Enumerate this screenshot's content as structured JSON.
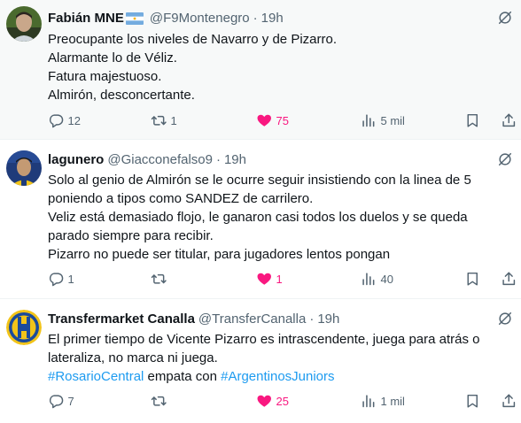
{
  "colors": {
    "like_active": "#f91880",
    "hashtag": "#1d9bf0",
    "secondary_text": "#536471",
    "primary_text": "#0f1419"
  },
  "tweets": [
    {
      "display_name": "Fabián MNE",
      "has_flag": "argentina-flag",
      "handle": "@F9Montenegro",
      "time": "19h",
      "lines": [
        "Preocupante los niveles de Navarro y de Pizarro.",
        "Alarmante lo de Véliz.",
        "Fatura majestuoso.",
        "Almirón, desconcertante."
      ],
      "replies": "12",
      "retweets": "1",
      "likes": "75",
      "views": "5 mil"
    },
    {
      "display_name": "lagunero",
      "handle": "@Giacconefalso9",
      "time": "19h",
      "lines": [
        "Solo al genio de Almirón se le ocurre seguir insistiendo con la linea de 5",
        "poniendo a tipos como SANDEZ de carrilero.",
        "Veliz está demasiado flojo, le ganaron casi todos los duelos y se queda",
        "parado siempre para recibir.",
        "Pizarro no puede ser titular, para jugadores lentos pongan"
      ],
      "replies": "1",
      "retweets": "",
      "likes": "1",
      "views": "40"
    },
    {
      "display_name": "Transfermarket Canalla",
      "handle": "@TransferCanalla",
      "time": "19h",
      "lines": [
        "El primer tiempo de Vicente Pizarro es intrascendente, juega para atrás o",
        "lateraliza, no marca ni juega."
      ],
      "hashtag_line": {
        "tag1": "#RosarioCentral",
        "middle": " empata con ",
        "tag2": "#ArgentinosJuniors"
      },
      "replies": "7",
      "retweets": "",
      "likes": "25",
      "views": "1 mil"
    }
  ],
  "separator": "·"
}
